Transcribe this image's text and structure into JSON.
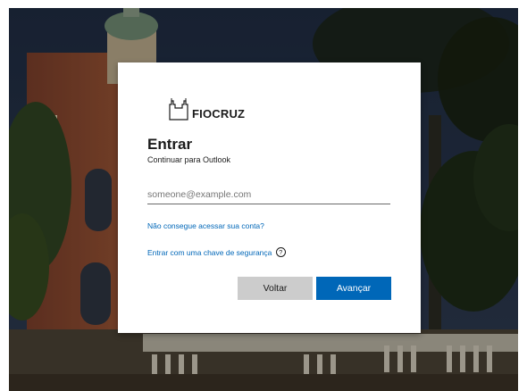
{
  "brand": {
    "logo_text": "FIOCRUZ"
  },
  "signin": {
    "title": "Entrar",
    "subtitle": "Continuar para Outlook",
    "email_placeholder": "someone@example.com",
    "email_value": "",
    "cant_access_link": "Não consegue acessar sua conta?",
    "security_key_link": "Entrar com uma chave de segurança",
    "help_glyph": "?",
    "back_label": "Voltar",
    "next_label": "Avançar"
  },
  "colors": {
    "accent": "#0067b8",
    "back_button": "#cccccc",
    "text": "#1b1b1b"
  },
  "icons": {
    "logo": "fiocruz-castle-icon",
    "help": "help-circle-icon"
  }
}
